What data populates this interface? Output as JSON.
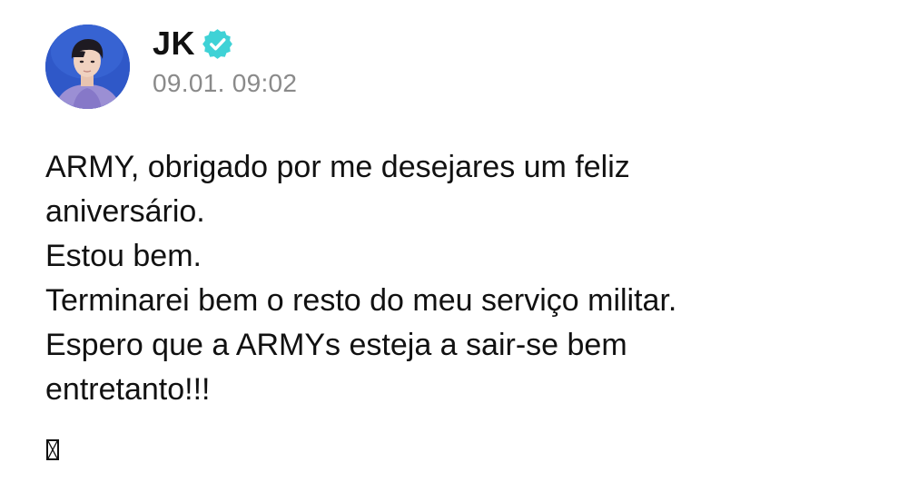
{
  "post": {
    "author": {
      "name": "JK",
      "verified": true,
      "avatar": "profile-photo"
    },
    "timestamp": "09.01. 09:02",
    "body_lines": [
      "ARMY, obrigado por me desejares um feliz",
      "aniversário.",
      "Estou bem.",
      "Terminarei bem o resto do meu serviço militar.",
      "Espero que a ARMYs esteja a sair-se bem",
      "entretanto!!!"
    ],
    "trailing_glyph": "missing-glyph-box"
  },
  "colors": {
    "verified_badge": "#3fd2d6",
    "timestamp": "#8a8a8a",
    "text": "#111111",
    "avatar_background": "#2e56c4"
  }
}
